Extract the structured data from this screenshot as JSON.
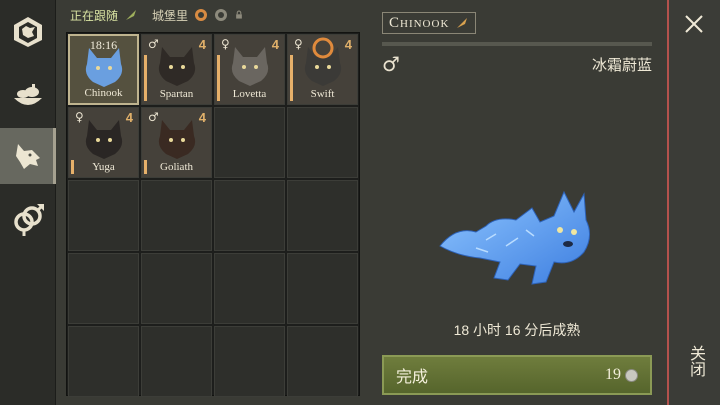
{
  "status": {
    "following_label": "正在跟随",
    "location_label": "城堡里"
  },
  "wolves": [
    {
      "name": "Chinook",
      "top": "18:16",
      "age": "",
      "sex": "",
      "color": "#6a9fe0",
      "selected": true
    },
    {
      "name": "Spartan",
      "top": "",
      "age": "4",
      "sex": "♂",
      "color": "#2f2a26",
      "selected": false
    },
    {
      "name": "Lovetta",
      "top": "",
      "age": "4",
      "sex": "♀",
      "color": "#6a6660",
      "selected": false
    },
    {
      "name": "Swift",
      "top": "",
      "age": "4",
      "sex": "♀",
      "color": "#3b3a37",
      "selected": false,
      "badge": true
    },
    {
      "name": "Yuga",
      "top": "",
      "age": "4",
      "sex": "♀",
      "color": "#2a2624",
      "selected": false
    },
    {
      "name": "Goliath",
      "top": "",
      "age": "4",
      "sex": "♂",
      "color": "#3a2a22",
      "selected": false
    }
  ],
  "detail": {
    "name": "Chinook",
    "sex_symbol": "♂",
    "breed": "冰霜蔚蓝",
    "time_left": "18 小时 16 分后成熟",
    "finish_label": "完成",
    "finish_cost": "19"
  },
  "close_label": "关闭"
}
